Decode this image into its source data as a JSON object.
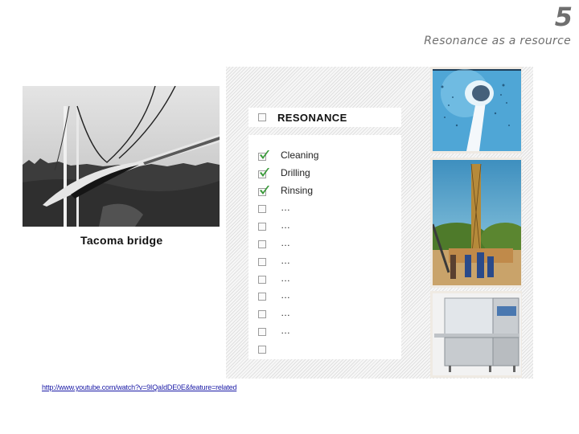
{
  "header": {
    "slide_number": "5",
    "subtitle": "Resonance as a resource"
  },
  "left_figure": {
    "image_alt": "Black-and-white photo of the Tacoma Narrows suspension bridge twisting",
    "caption": "Tacoma bridge",
    "link_text": "http://www.youtube.com/watch?v=9IQaIdDE0E&feature=related"
  },
  "checklist": {
    "title": "RESONANCE",
    "title_checked": false,
    "items": [
      {
        "label": "Cleaning",
        "checked": true
      },
      {
        "label": "Drilling",
        "checked": true
      },
      {
        "label": "Rinsing",
        "checked": true
      },
      {
        "label": "…",
        "checked": false
      },
      {
        "label": "…",
        "checked": false
      },
      {
        "label": "…",
        "checked": false
      },
      {
        "label": "…",
        "checked": false
      },
      {
        "label": "…",
        "checked": false
      },
      {
        "label": "…",
        "checked": false
      },
      {
        "label": "…",
        "checked": false
      },
      {
        "label": "…",
        "checked": false
      },
      {
        "label": "",
        "checked": false
      }
    ]
  },
  "right_images": [
    {
      "alt": "Electric toothbrush head splashing in blue water"
    },
    {
      "alt": "Workers at a drilling rig under blue sky"
    },
    {
      "alt": "Stainless steel industrial rinsing machine"
    }
  ],
  "colors": {
    "check_green": "#3a9a3a",
    "link_blue": "#1a1aa6",
    "title_gray": "#6f6f6f"
  }
}
